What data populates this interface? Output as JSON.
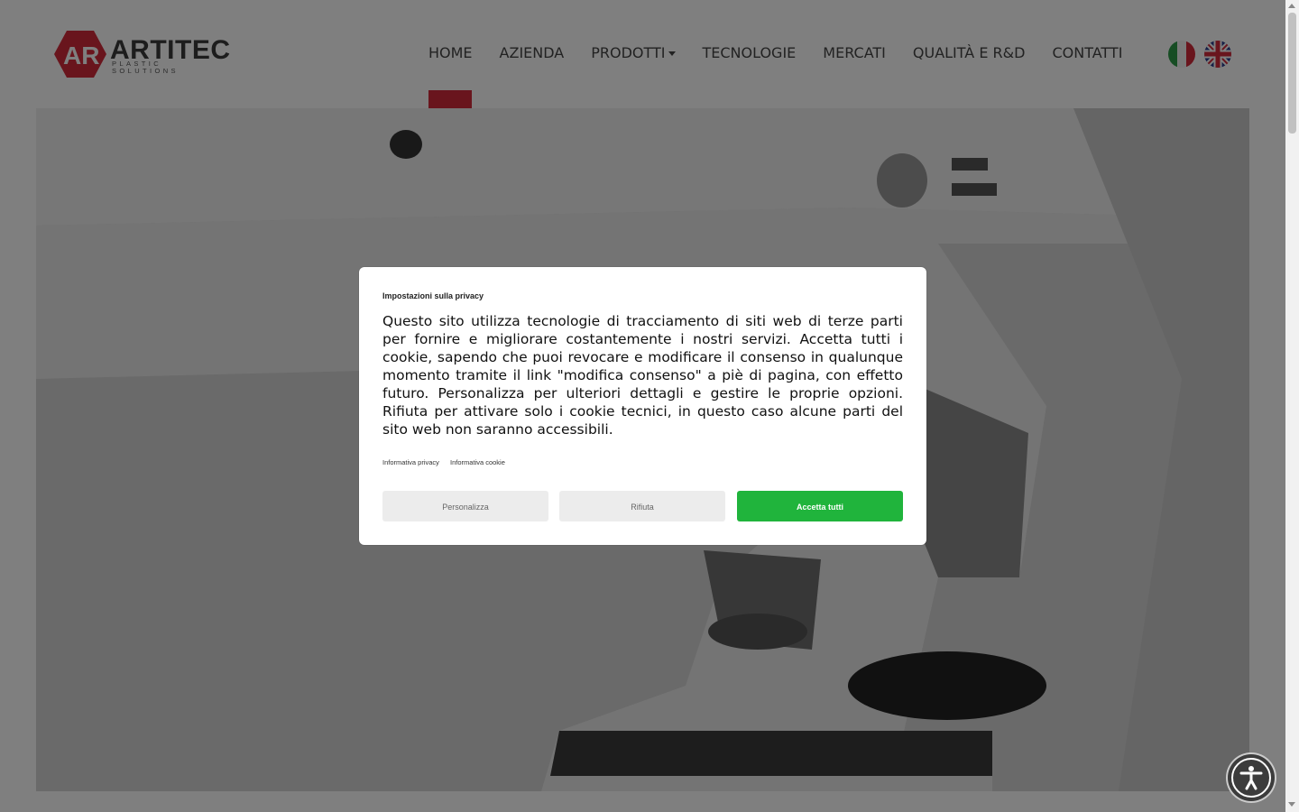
{
  "brand": {
    "name": "ARTITEC",
    "tagline": "PLASTIC SOLUTIONS",
    "accent_color": "#d32b3a"
  },
  "nav": {
    "items": [
      {
        "label": "HOME",
        "active": true
      },
      {
        "label": "AZIENDA"
      },
      {
        "label": "PRODOTTI",
        "dropdown": true
      },
      {
        "label": "TECNOLOGIE"
      },
      {
        "label": "MERCATI"
      },
      {
        "label": "QUALITÀ E R&D"
      },
      {
        "label": "CONTATTI"
      }
    ]
  },
  "languages": [
    {
      "code": "it",
      "icon": "italian-flag-icon"
    },
    {
      "code": "en",
      "icon": "uk-flag-icon"
    }
  ],
  "hero": {
    "image": "microscope-photo"
  },
  "cookie_modal": {
    "title": "Impostazioni sulla privacy",
    "body": "Questo sito utilizza tecnologie di tracciamento di siti web di terze parti per fornire e migliorare costantemente i nostri servizi. Accetta tutti i cookie, sapendo che puoi revocare e modificare il consenso in qualunque momento tramite il link \"modifica consenso\" a piè di pagina, con effetto futuro. Personalizza per ulteriori dettagli e gestire le proprie opzioni. Rifiuta per attivare solo i cookie tecnici, in questo caso alcune parti del sito web non saranno accessibili.",
    "links": {
      "privacy": "Informativa privacy",
      "cookie": "Informativa cookie"
    },
    "buttons": {
      "customize": "Personalizza",
      "reject": "Rifiuta",
      "accept": "Accetta tutti"
    },
    "accept_color": "#20b43c"
  },
  "accessibility": {
    "icon": "accessibility-icon"
  }
}
